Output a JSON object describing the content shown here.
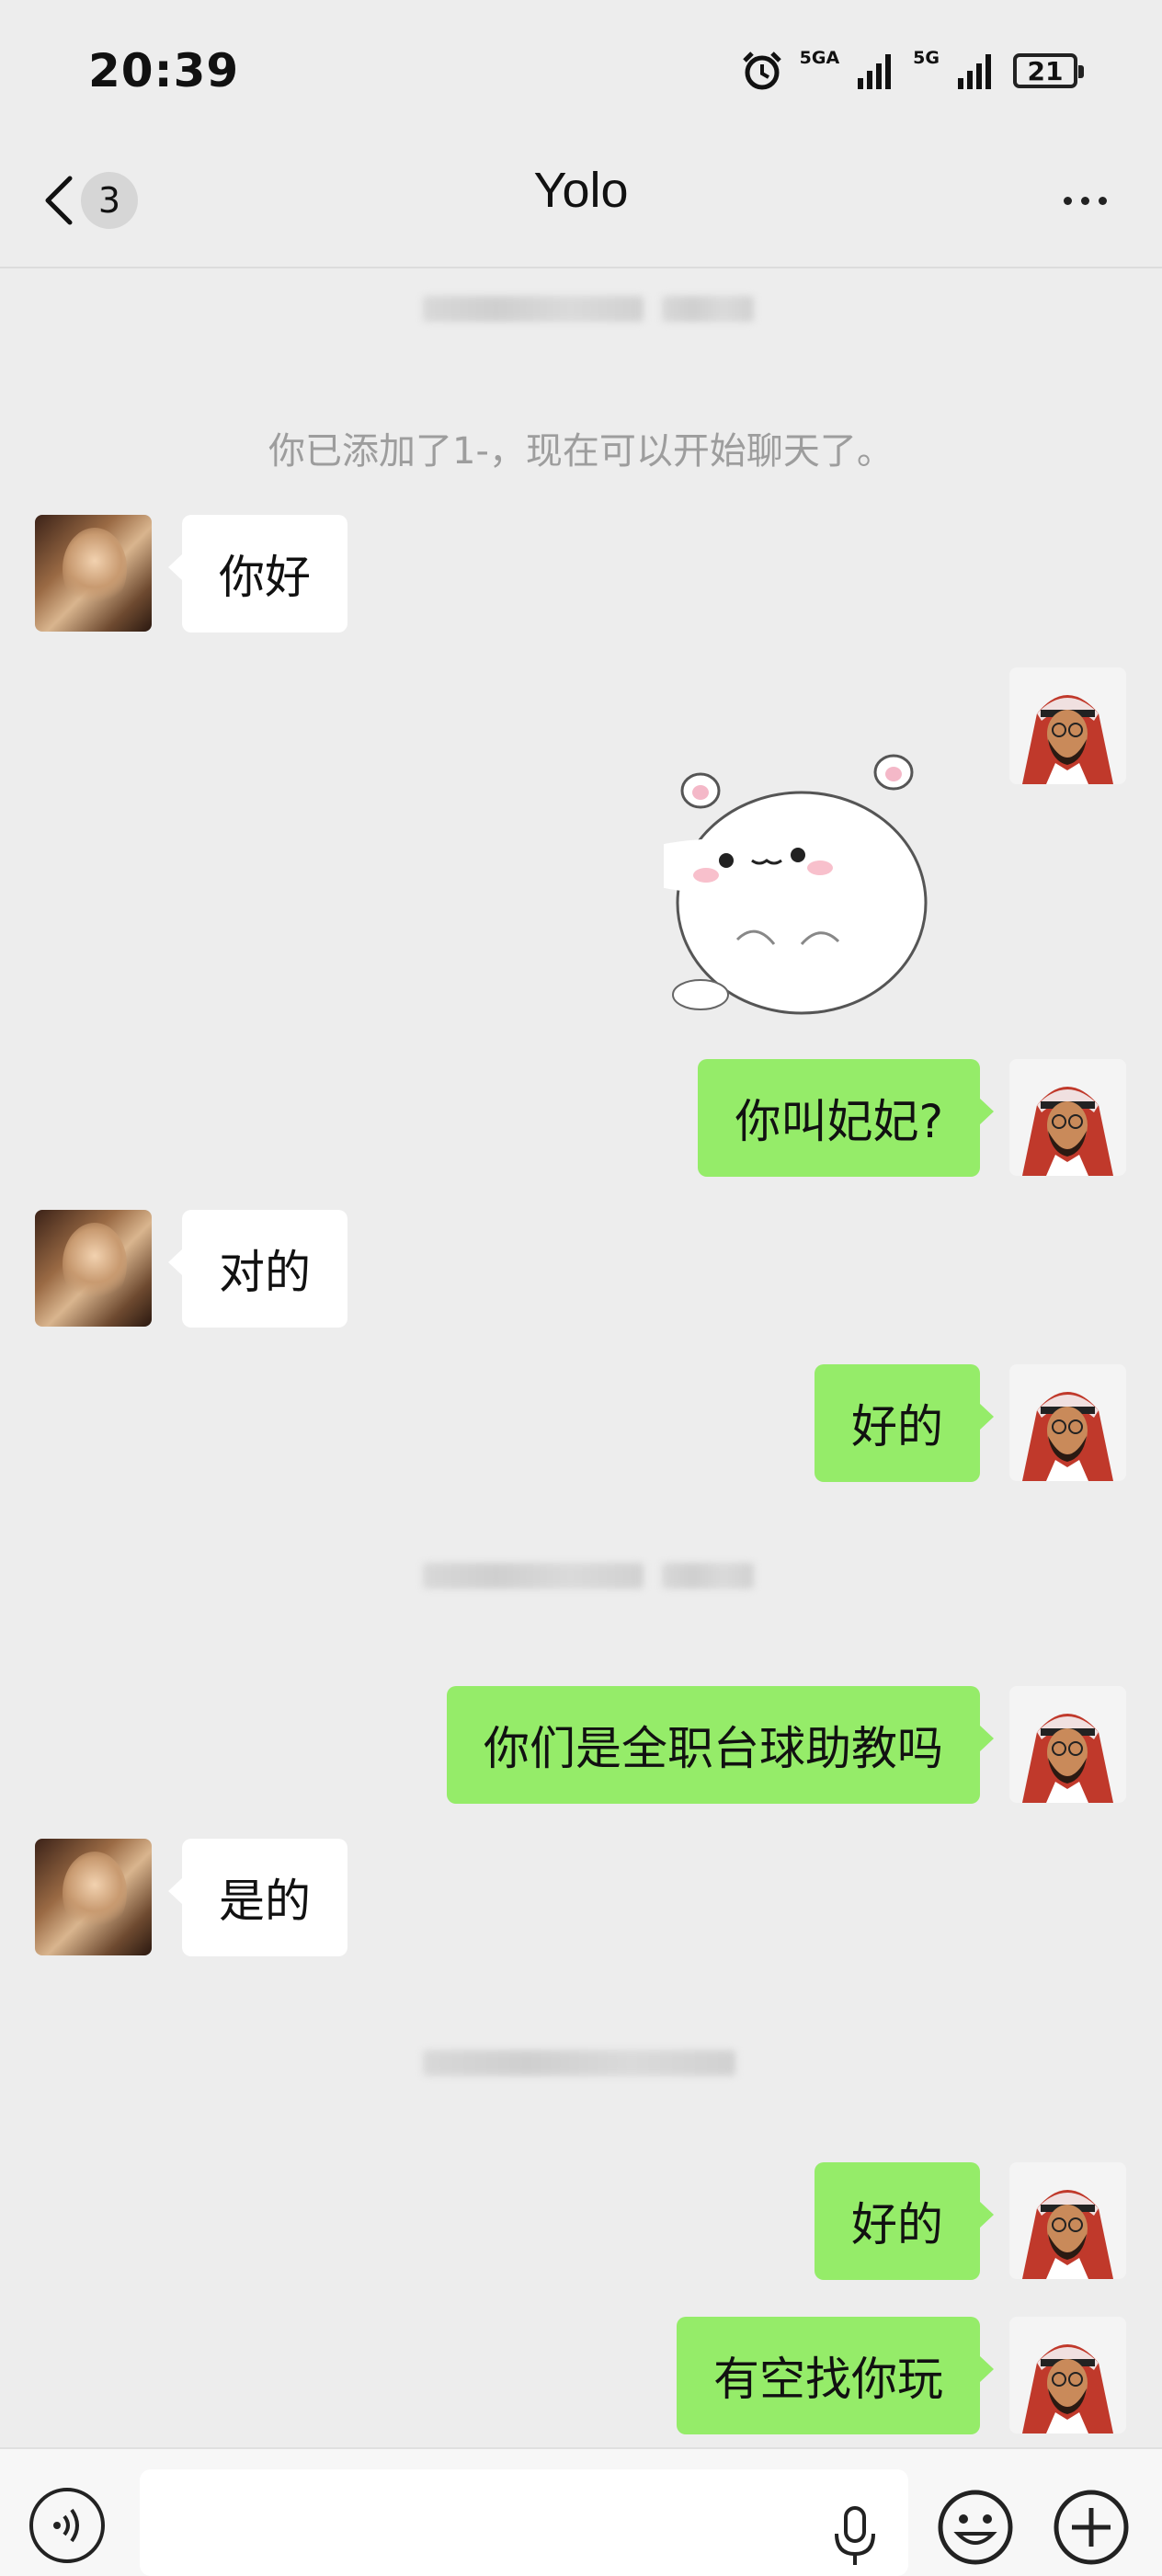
{
  "status_bar": {
    "time": "20:39",
    "network_1": "5GA",
    "network_2": "5G",
    "battery": "21"
  },
  "nav": {
    "back_count": "3",
    "title": "Yolo",
    "more_icon": "more-dots-icon"
  },
  "chat": {
    "system_message": "你已添加了1-，现在可以开始聊天了。",
    "messages": [
      {
        "side": "left",
        "text": "你好"
      },
      {
        "side": "right",
        "type": "sticker",
        "icon": "white-hamster-sticker"
      },
      {
        "side": "right",
        "text": "你叫妃妃?"
      },
      {
        "side": "left",
        "text": "对的"
      },
      {
        "side": "right",
        "text": "好的"
      },
      {
        "side": "right",
        "text": "你们是全职台球助教吗"
      },
      {
        "side": "left",
        "text": "是的"
      },
      {
        "side": "right",
        "text": "好的"
      },
      {
        "side": "right",
        "text": "有空找你玩"
      }
    ]
  },
  "input_bar": {
    "voice_icon": "voice-mode-icon",
    "mic_icon": "microphone-icon",
    "emoji_icon": "emoji-icon",
    "plus_icon": "plus-icon",
    "value": ""
  },
  "colors": {
    "background": "#ededed",
    "my_bubble": "#95ec69",
    "their_bubble": "#ffffff",
    "system_text": "#9d9d9d"
  }
}
